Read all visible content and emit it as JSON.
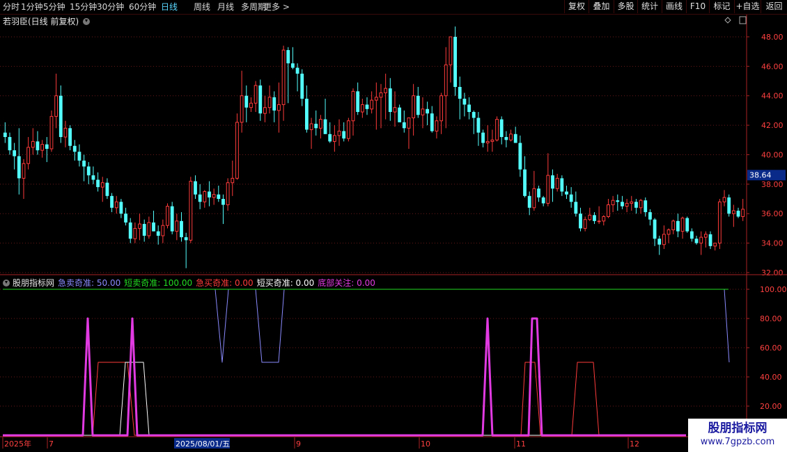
{
  "toolbar": {
    "periods": [
      "分时",
      "1分钟",
      "5分钟",
      "15分钟",
      "30分钟",
      "60分钟",
      "日线",
      "周线",
      "月线",
      "多周期",
      "更多 >"
    ],
    "active_period": "日线",
    "right_buttons": [
      "复权",
      "叠加",
      "多股",
      "统计",
      "画线",
      "F10",
      "标记",
      "+自选",
      "返回"
    ]
  },
  "main": {
    "title": "若羽臣(日线 前复权)",
    "price_ticks": [
      "48.00",
      "46.00",
      "44.00",
      "42.00",
      "40.00",
      "38.00",
      "36.00",
      "34.00",
      "32.00"
    ],
    "last_price": "38.64"
  },
  "indicator": {
    "name": "股朋指标网",
    "params": [
      {
        "label": "急卖奇准:",
        "value": "50.00",
        "color": "#8a8aff"
      },
      {
        "label": "短卖奇准:",
        "value": "100.00",
        "color": "#22dd22"
      },
      {
        "label": "急买奇准:",
        "value": "0.00",
        "color": "#ff3b3b"
      },
      {
        "label": "短买奇准:",
        "value": "0.00",
        "color": "#ffffff"
      },
      {
        "label": "底部关注:",
        "value": "0.00",
        "color": "#e23ae2"
      }
    ],
    "ticks": [
      "100.00",
      "80.00",
      "60.00",
      "40.00",
      "20.00"
    ]
  },
  "date_axis": {
    "labels": [
      "2025年",
      "7",
      "8",
      "9",
      "10",
      "11",
      "12"
    ],
    "cursor_date": "2025/08/01/五"
  },
  "watermark": {
    "line1": "股朋指标网",
    "line2": "www.7gpzb.com"
  },
  "colors": {
    "up": "#ff3b3b",
    "down": "#54ffff",
    "grid": "#6a1a1a"
  },
  "chart_data": {
    "type": "candlestick",
    "candles": [
      [
        41.5,
        42.2,
        40.8,
        41.2
      ],
      [
        41.2,
        41.5,
        40.0,
        40.3
      ],
      [
        40.3,
        40.8,
        39.0,
        39.9
      ],
      [
        39.9,
        41.8,
        37.3,
        38.4
      ],
      [
        38.4,
        39.7,
        37.0,
        39.4
      ],
      [
        39.4,
        41.2,
        39.0,
        40.5
      ],
      [
        40.5,
        41.8,
        40.0,
        40.9
      ],
      [
        40.9,
        41.6,
        40.0,
        40.3
      ],
      [
        40.3,
        41.0,
        39.8,
        40.7
      ],
      [
        40.7,
        41.2,
        39.5,
        40.4
      ],
      [
        40.4,
        43.0,
        40.2,
        42.6
      ],
      [
        42.6,
        45.5,
        41.8,
        44.0
      ],
      [
        44.0,
        44.7,
        40.8,
        41.2
      ],
      [
        41.2,
        42.3,
        40.5,
        41.8
      ],
      [
        41.8,
        42.0,
        40.3,
        40.6
      ],
      [
        40.6,
        41.0,
        39.6,
        40.2
      ],
      [
        40.2,
        40.7,
        39.2,
        39.6
      ],
      [
        39.6,
        40.0,
        38.2,
        39.2
      ],
      [
        39.2,
        39.5,
        38.0,
        38.6
      ],
      [
        38.6,
        39.2,
        38.0,
        38.3
      ],
      [
        38.3,
        38.8,
        37.5,
        37.8
      ],
      [
        37.8,
        38.5,
        36.8,
        38.1
      ],
      [
        38.1,
        38.4,
        37.0,
        37.2
      ],
      [
        37.2,
        37.4,
        36.1,
        36.4
      ],
      [
        36.4,
        37.2,
        36.0,
        36.8
      ],
      [
        36.8,
        37.0,
        35.7,
        36.0
      ],
      [
        36.0,
        36.4,
        35.2,
        35.4
      ],
      [
        35.4,
        35.7,
        34.0,
        34.3
      ],
      [
        34.3,
        35.4,
        34.0,
        35.0
      ],
      [
        35.0,
        36.0,
        34.2,
        35.3
      ],
      [
        35.3,
        35.6,
        34.1,
        34.5
      ],
      [
        34.5,
        35.8,
        34.3,
        35.4
      ],
      [
        35.4,
        36.2,
        34.8,
        34.8
      ],
      [
        34.8,
        35.2,
        33.9,
        34.5
      ],
      [
        34.5,
        35.6,
        34.0,
        35.2
      ],
      [
        35.2,
        36.7,
        35.0,
        36.5
      ],
      [
        36.5,
        36.8,
        34.6,
        34.8
      ],
      [
        34.8,
        36.0,
        34.2,
        35.5
      ],
      [
        35.5,
        36.1,
        34.1,
        34.4
      ],
      [
        34.4,
        34.7,
        32.3,
        34.2
      ],
      [
        34.2,
        38.5,
        34.0,
        38.2
      ],
      [
        38.2,
        38.6,
        37.0,
        37.3
      ],
      [
        37.3,
        38.0,
        36.3,
        36.8
      ],
      [
        36.8,
        37.6,
        36.4,
        37.5
      ],
      [
        37.5,
        38.2,
        36.5,
        37.1
      ],
      [
        37.1,
        37.7,
        36.6,
        37.3
      ],
      [
        37.3,
        37.9,
        36.8,
        37.0
      ],
      [
        37.0,
        37.3,
        35.3,
        36.6
      ],
      [
        36.6,
        38.4,
        36.2,
        38.1
      ],
      [
        38.1,
        39.6,
        37.2,
        38.4
      ],
      [
        38.4,
        42.8,
        38.3,
        42.2
      ],
      [
        42.2,
        45.7,
        41.5,
        44.0
      ],
      [
        44.0,
        44.7,
        42.2,
        43.2
      ],
      [
        43.2,
        43.9,
        42.9,
        43.5
      ],
      [
        43.5,
        45.0,
        42.9,
        44.7
      ],
      [
        44.7,
        45.1,
        42.3,
        42.8
      ],
      [
        42.8,
        44.0,
        42.2,
        43.2
      ],
      [
        43.2,
        44.7,
        42.8,
        43.9
      ],
      [
        43.9,
        44.3,
        42.2,
        43.0
      ],
      [
        43.0,
        44.9,
        41.5,
        43.4
      ],
      [
        43.4,
        47.4,
        42.3,
        47.1
      ],
      [
        47.1,
        47.3,
        43.5,
        46.2
      ],
      [
        46.2,
        47.3,
        45.8,
        45.9
      ],
      [
        45.9,
        46.2,
        44.3,
        45.5
      ],
      [
        45.5,
        45.8,
        43.3,
        43.8
      ],
      [
        43.8,
        44.7,
        41.5,
        41.7
      ],
      [
        41.7,
        42.5,
        40.4,
        42.1
      ],
      [
        42.1,
        43.0,
        41.3,
        41.8
      ],
      [
        41.8,
        42.7,
        41.1,
        42.4
      ],
      [
        42.4,
        43.8,
        42.0,
        41.4
      ],
      [
        41.4,
        42.2,
        40.8,
        40.9
      ],
      [
        40.9,
        42.0,
        40.2,
        41.3
      ],
      [
        41.3,
        42.4,
        40.6,
        41.6
      ],
      [
        41.6,
        42.2,
        40.9,
        41.1
      ],
      [
        41.1,
        42.5,
        40.9,
        42.3
      ],
      [
        42.3,
        44.5,
        41.3,
        44.3
      ],
      [
        44.3,
        44.9,
        42.7,
        42.9
      ],
      [
        42.9,
        43.8,
        42.5,
        43.4
      ],
      [
        43.4,
        43.9,
        42.7,
        43.1
      ],
      [
        43.1,
        44.3,
        42.8,
        43.7
      ],
      [
        43.7,
        44.9,
        41.7,
        43.9
      ],
      [
        43.9,
        44.8,
        41.8,
        44.2
      ],
      [
        44.2,
        45.5,
        42.4,
        44.5
      ],
      [
        44.5,
        45.2,
        42.3,
        42.9
      ],
      [
        42.9,
        44.3,
        41.9,
        43.2
      ],
      [
        43.2,
        43.4,
        42.4,
        42.2
      ],
      [
        42.2,
        43.0,
        41.5,
        41.8
      ],
      [
        41.8,
        42.2,
        40.4,
        42.5
      ],
      [
        42.5,
        44.8,
        41.3,
        44.0
      ],
      [
        44.0,
        44.6,
        42.5,
        42.7
      ],
      [
        42.7,
        43.9,
        41.8,
        43.1
      ],
      [
        43.1,
        43.6,
        42.0,
        42.8
      ],
      [
        42.8,
        43.3,
        41.5,
        41.6
      ],
      [
        41.6,
        42.6,
        41.1,
        42.3
      ],
      [
        42.3,
        44.2,
        41.4,
        44.0
      ],
      [
        44.0,
        47.3,
        41.8,
        46.1
      ],
      [
        46.1,
        47.9,
        44.9,
        48.0
      ],
      [
        48.0,
        48.7,
        44.0,
        44.6
      ],
      [
        44.6,
        45.3,
        42.4,
        43.8
      ],
      [
        43.8,
        44.2,
        42.6,
        43.4
      ],
      [
        43.4,
        43.9,
        42.4,
        42.9
      ],
      [
        42.9,
        43.0,
        41.4,
        42.5
      ],
      [
        42.5,
        42.9,
        40.6,
        41.5
      ],
      [
        41.5,
        41.7,
        40.5,
        40.8
      ],
      [
        40.8,
        42.0,
        40.2,
        40.9
      ],
      [
        40.9,
        41.7,
        40.2,
        41.0
      ],
      [
        41.0,
        42.6,
        40.9,
        42.4
      ],
      [
        42.4,
        42.6,
        40.7,
        41.2
      ],
      [
        41.2,
        41.6,
        40.5,
        41.0
      ],
      [
        41.0,
        41.7,
        40.9,
        41.4
      ],
      [
        41.4,
        41.9,
        40.8,
        40.8
      ],
      [
        40.8,
        41.3,
        38.5,
        39.0
      ],
      [
        39.0,
        39.9,
        37.1,
        37.2
      ],
      [
        37.2,
        37.5,
        35.9,
        36.4
      ],
      [
        36.4,
        38.9,
        36.2,
        37.7
      ],
      [
        37.7,
        37.9,
        36.8,
        37.1
      ],
      [
        37.1,
        37.2,
        36.5,
        36.7
      ],
      [
        36.7,
        40.1,
        36.5,
        38.6
      ],
      [
        38.6,
        39.0,
        36.8,
        37.7
      ],
      [
        37.7,
        38.7,
        37.5,
        38.4
      ],
      [
        38.4,
        38.6,
        37.2,
        37.5
      ],
      [
        37.5,
        37.9,
        37.0,
        37.3
      ],
      [
        37.3,
        37.8,
        36.4,
        36.8
      ],
      [
        36.8,
        37.5,
        35.8,
        36.0
      ],
      [
        36.0,
        36.4,
        34.8,
        35.0
      ],
      [
        35.0,
        35.8,
        34.8,
        35.6
      ],
      [
        35.6,
        36.4,
        35.5,
        35.9
      ],
      [
        35.9,
        36.1,
        35.3,
        35.5
      ],
      [
        35.5,
        36.5,
        35.3,
        35.5
      ],
      [
        35.5,
        35.9,
        35.2,
        35.8
      ],
      [
        35.8,
        37.0,
        35.7,
        36.6
      ],
      [
        36.6,
        37.2,
        36.1,
        36.9
      ],
      [
        36.9,
        37.3,
        36.2,
        36.8
      ],
      [
        36.8,
        37.2,
        36.3,
        36.5
      ],
      [
        36.5,
        37.0,
        36.1,
        36.7
      ],
      [
        36.7,
        37.2,
        36.2,
        36.8
      ],
      [
        36.8,
        37.0,
        36.0,
        36.4
      ],
      [
        36.4,
        37.0,
        36.0,
        36.9
      ],
      [
        36.9,
        37.1,
        35.8,
        36.1
      ],
      [
        36.1,
        36.3,
        35.2,
        35.6
      ],
      [
        35.6,
        35.7,
        33.8,
        34.3
      ],
      [
        34.3,
        34.5,
        33.2,
        33.9
      ],
      [
        33.9,
        35.2,
        33.6,
        34.6
      ],
      [
        34.6,
        35.0,
        34.0,
        34.9
      ],
      [
        34.9,
        35.6,
        34.6,
        35.5
      ],
      [
        35.5,
        36.0,
        34.4,
        34.8
      ],
      [
        34.8,
        35.8,
        34.3,
        35.7
      ],
      [
        35.7,
        35.8,
        34.7,
        34.8
      ],
      [
        34.8,
        35.0,
        34.1,
        34.3
      ],
      [
        34.3,
        34.5,
        33.9,
        34.0
      ],
      [
        34.0,
        34.8,
        33.2,
        34.4
      ],
      [
        34.4,
        34.8,
        33.7,
        34.6
      ],
      [
        34.6,
        34.8,
        33.6,
        33.8
      ],
      [
        33.8,
        34.0,
        33.5,
        34.0
      ],
      [
        34.0,
        37.0,
        33.6,
        36.8
      ],
      [
        36.8,
        37.6,
        36.5,
        37.1
      ],
      [
        37.1,
        37.3,
        35.8,
        36.0
      ],
      [
        36.0,
        36.6,
        35.1,
        36.2
      ],
      [
        36.2,
        36.4,
        35.7,
        35.8
      ],
      [
        35.8,
        37.0,
        35.5,
        36.3
      ]
    ],
    "price_range": [
      32.0,
      48.8
    ],
    "indicator_series": [
      {
        "name": "急卖奇准",
        "color": "#8a8aff",
        "segments": [
          [
            309,
            100
          ],
          [
            319,
            50
          ],
          [
            328,
            100
          ],
          [
            367,
            100
          ],
          [
            376,
            50
          ],
          [
            400,
            50
          ],
          [
            408,
            100
          ],
          [
            1040,
            100
          ],
          [
            1047,
            50
          ]
        ]
      },
      {
        "name": "短卖奇准",
        "color": "#22dd22",
        "segments": [
          [
            4,
            100
          ],
          [
            1046,
            100
          ]
        ]
      },
      {
        "name": "急买奇准",
        "color": "#ff3b3b",
        "segments": [
          [
            4,
            0
          ],
          [
            133,
            0
          ],
          [
            141,
            50
          ],
          [
            183,
            50
          ],
          [
            193,
            0
          ],
          [
            748,
            0
          ],
          [
            754,
            50
          ],
          [
            768,
            50
          ],
          [
            776,
            0
          ],
          [
            821,
            0
          ],
          [
            829,
            50
          ],
          [
            852,
            50
          ],
          [
            860,
            0
          ],
          [
            985,
            0
          ]
        ]
      },
      {
        "name": "短买奇准",
        "color": "#ffffff",
        "segments": [
          [
            4,
            0
          ],
          [
            172,
            0
          ],
          [
            180,
            50
          ],
          [
            206,
            50
          ],
          [
            214,
            0
          ],
          [
            985,
            0
          ]
        ]
      },
      {
        "name": "底部关注",
        "color": "#e23ae2",
        "segments": [
          [
            4,
            0
          ],
          [
            119,
            0
          ],
          [
            126,
            80
          ],
          [
            133,
            0
          ],
          [
            183,
            0
          ],
          [
            190,
            80
          ],
          [
            197,
            0
          ],
          [
            693,
            0
          ],
          [
            700,
            80
          ],
          [
            707,
            0
          ],
          [
            759,
            0
          ],
          [
            764,
            80
          ],
          [
            771,
            80
          ],
          [
            778,
            0
          ],
          [
            985,
            0
          ]
        ]
      }
    ],
    "indicator_range": [
      0,
      100
    ]
  }
}
